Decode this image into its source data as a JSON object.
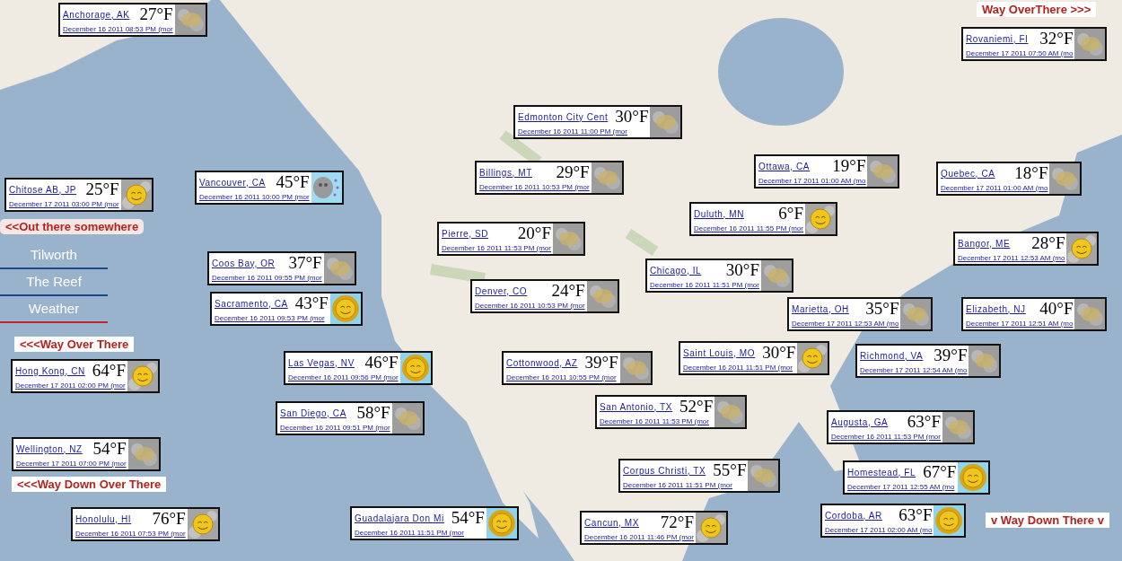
{
  "nav": [
    {
      "label": "Tilworth",
      "selected": false
    },
    {
      "label": "The Reef",
      "selected": false
    },
    {
      "label": "Weather",
      "selected": true
    }
  ],
  "region_links": [
    {
      "text": "Way OverThere >>>"
    },
    {
      "text": "<<Out there somewhere"
    },
    {
      "text": "<<<Way Over There"
    },
    {
      "text": "<<<Way Down Over There"
    },
    {
      "text": "v Way Down There v"
    }
  ],
  "stations": [
    {
      "city": "Anchorage, AK",
      "temp": "27°F",
      "time": "December 16 2011 08:53 PM (mor",
      "kind": "cloudy"
    },
    {
      "city": "Rovaniemi, FI",
      "temp": "32°F",
      "time": "December 17 2011 07:50 AM (mo",
      "kind": "cloudy"
    },
    {
      "city": "Edmonton City Cent",
      "temp": "30°F",
      "time": "December 16 2011 11:00 PM (mor",
      "kind": "cloudy"
    },
    {
      "city": "Billings, MT",
      "temp": "29°F",
      "time": "December 16 2011 10:53 PM (mor",
      "kind": "cloudy"
    },
    {
      "city": "Ottawa, CA",
      "temp": "19°F",
      "time": "December 17 2011 01:00 AM (mo",
      "kind": "cloudy"
    },
    {
      "city": "Quebec, CA",
      "temp": "18°F",
      "time": "December 17 2011 01:00 AM (mo",
      "kind": "cloudy"
    },
    {
      "city": "Chitose AB, JP",
      "temp": "25°F",
      "time": "December 17 2011 03:00 PM (mor",
      "kind": "partly_sunny"
    },
    {
      "city": "Vancouver, CA",
      "temp": "45°F",
      "time": "December 16 2011 10:00 PM (mor",
      "kind": "showers"
    },
    {
      "city": "Duluth, MN",
      "temp": "6°F",
      "time": "December 16 2011 11:55 PM (mor",
      "kind": "partly_sunny"
    },
    {
      "city": "Pierre, SD",
      "temp": "20°F",
      "time": "December 16 2011 11:53 PM (mor",
      "kind": "cloudy"
    },
    {
      "city": "Bangor, ME",
      "temp": "28°F",
      "time": "December 17 2011 12:53 AM (mo",
      "kind": "partly_sunny"
    },
    {
      "city": "Coos Bay, OR",
      "temp": "37°F",
      "time": "December 16 2011 09:55 PM (mor",
      "kind": "cloudy"
    },
    {
      "city": "Chicago, IL",
      "temp": "30°F",
      "time": "December 16 2011 11:51 PM (mor",
      "kind": "cloudy"
    },
    {
      "city": "Denver, CO",
      "temp": "24°F",
      "time": "December 16 2011 10:53 PM (mor",
      "kind": "cloudy"
    },
    {
      "city": "Sacramento, CA",
      "temp": "43°F",
      "time": "December 16 2011 09:53 PM (mor",
      "kind": "sunny"
    },
    {
      "city": "Marietta, OH",
      "temp": "35°F",
      "time": "December 17 2011 12:53 AM (mo",
      "kind": "cloudy"
    },
    {
      "city": "Elizabeth, NJ",
      "temp": "40°F",
      "time": "December 17 2011 12:51 AM (mo",
      "kind": "cloudy"
    },
    {
      "city": "Saint Louis, MO",
      "temp": "30°F",
      "time": "December 16 2011 11:51 PM (mor",
      "kind": "partly_sunny"
    },
    {
      "city": "Richmond, VA",
      "temp": "39°F",
      "time": "December 17 2011 12:54 AM (mo",
      "kind": "cloudy"
    },
    {
      "city": "Las Vegas, NV",
      "temp": "46°F",
      "time": "December 16 2011 09:56 PM (mor",
      "kind": "sunny"
    },
    {
      "city": "Cottonwood, AZ",
      "temp": "39°F",
      "time": "December 16 2011 10:55 PM (mor",
      "kind": "cloudy"
    },
    {
      "city": "Hong Kong, CN",
      "temp": "64°F",
      "time": "December 17 2011 02:00 PM (mor",
      "kind": "partly_sunny"
    },
    {
      "city": "San Diego, CA",
      "temp": "58°F",
      "time": "December 16 2011 09:51 PM (mor",
      "kind": "cloudy"
    },
    {
      "city": "San Antonio, TX",
      "temp": "52°F",
      "time": "December 16 2011 11:53 PM (mor",
      "kind": "cloudy"
    },
    {
      "city": "Augusta, GA",
      "temp": "63°F",
      "time": "December 16 2011 11:53 PM (mor",
      "kind": "cloudy"
    },
    {
      "city": "Wellington, NZ",
      "temp": "54°F",
      "time": "December 17 2011 07:00 PM (mor",
      "kind": "cloudy"
    },
    {
      "city": "Corpus Christi, TX",
      "temp": "55°F",
      "time": "December 16 2011 11:51 PM (mor",
      "kind": "cloudy"
    },
    {
      "city": "Homestead, FL",
      "temp": "67°F",
      "time": "December 17 2011 12:55 AM (mo",
      "kind": "sunny"
    },
    {
      "city": "Honolulu, HI",
      "temp": "76°F",
      "time": "December 16 2011 07:53 PM (mor",
      "kind": "partly_sunny"
    },
    {
      "city": "Guadalajara Don Mi",
      "temp": "54°F",
      "time": "December 16 2011 11:51 PM (mor",
      "kind": "sunny"
    },
    {
      "city": "Cancun, MX",
      "temp": "72°F",
      "time": "December 16 2011 11:46 PM (mor",
      "kind": "partly_sunny"
    },
    {
      "city": "Cordoba, AR",
      "temp": "63°F",
      "time": "December 17 2011 02:00 AM (mo",
      "kind": "sunny"
    }
  ]
}
